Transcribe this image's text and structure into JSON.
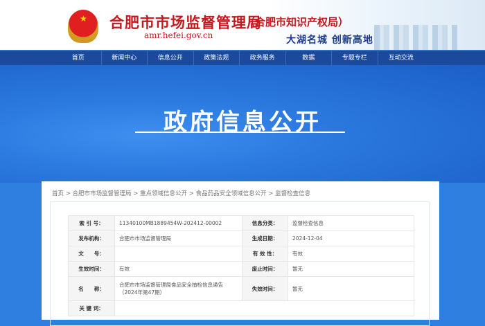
{
  "header": {
    "title": "合肥市市场监督管理局",
    "subtitle": "（合肥市知识产权局）",
    "domain": "amr.hefei.gov.cn",
    "slogan": "大湖名城  创新高地"
  },
  "nav": [
    "首页",
    "新闻中心",
    "信息公开",
    "政策法规",
    "政务服务",
    "数据",
    "专题专栏",
    "互动交流"
  ],
  "banner": {
    "title": "政府信息公开"
  },
  "breadcrumb": "首页 > 合肥市市场监督管理局 > 重点领域信息公开 > 食品药品安全领域信息公开 > 监督检查信息",
  "table": {
    "rows": [
      {
        "l1": "索 引 号：",
        "v1": "11340100MB1889454W-202412-00002",
        "l2": "信息分类：",
        "v2": "监督检查信息"
      },
      {
        "l1": "发布机构：",
        "v1": "合肥市市场监督管理局",
        "l2": "生成日期：",
        "v2": "2024-12-04"
      },
      {
        "l1": "文　　号：",
        "v1": "",
        "l2": "有 效 性：",
        "v2": "有效"
      },
      {
        "l1": "生效时间：",
        "v1": "有效",
        "l2": "废止时间：",
        "v2": "暂无"
      },
      {
        "l1": "名　　称：",
        "v1": "合肥市市场监督管理局食品安全抽检信息通告（2024年第47期）",
        "l2": "失效时间：",
        "v2": "暂无"
      }
    ],
    "keyword_label": "关 键 词：",
    "keyword_value": ""
  }
}
